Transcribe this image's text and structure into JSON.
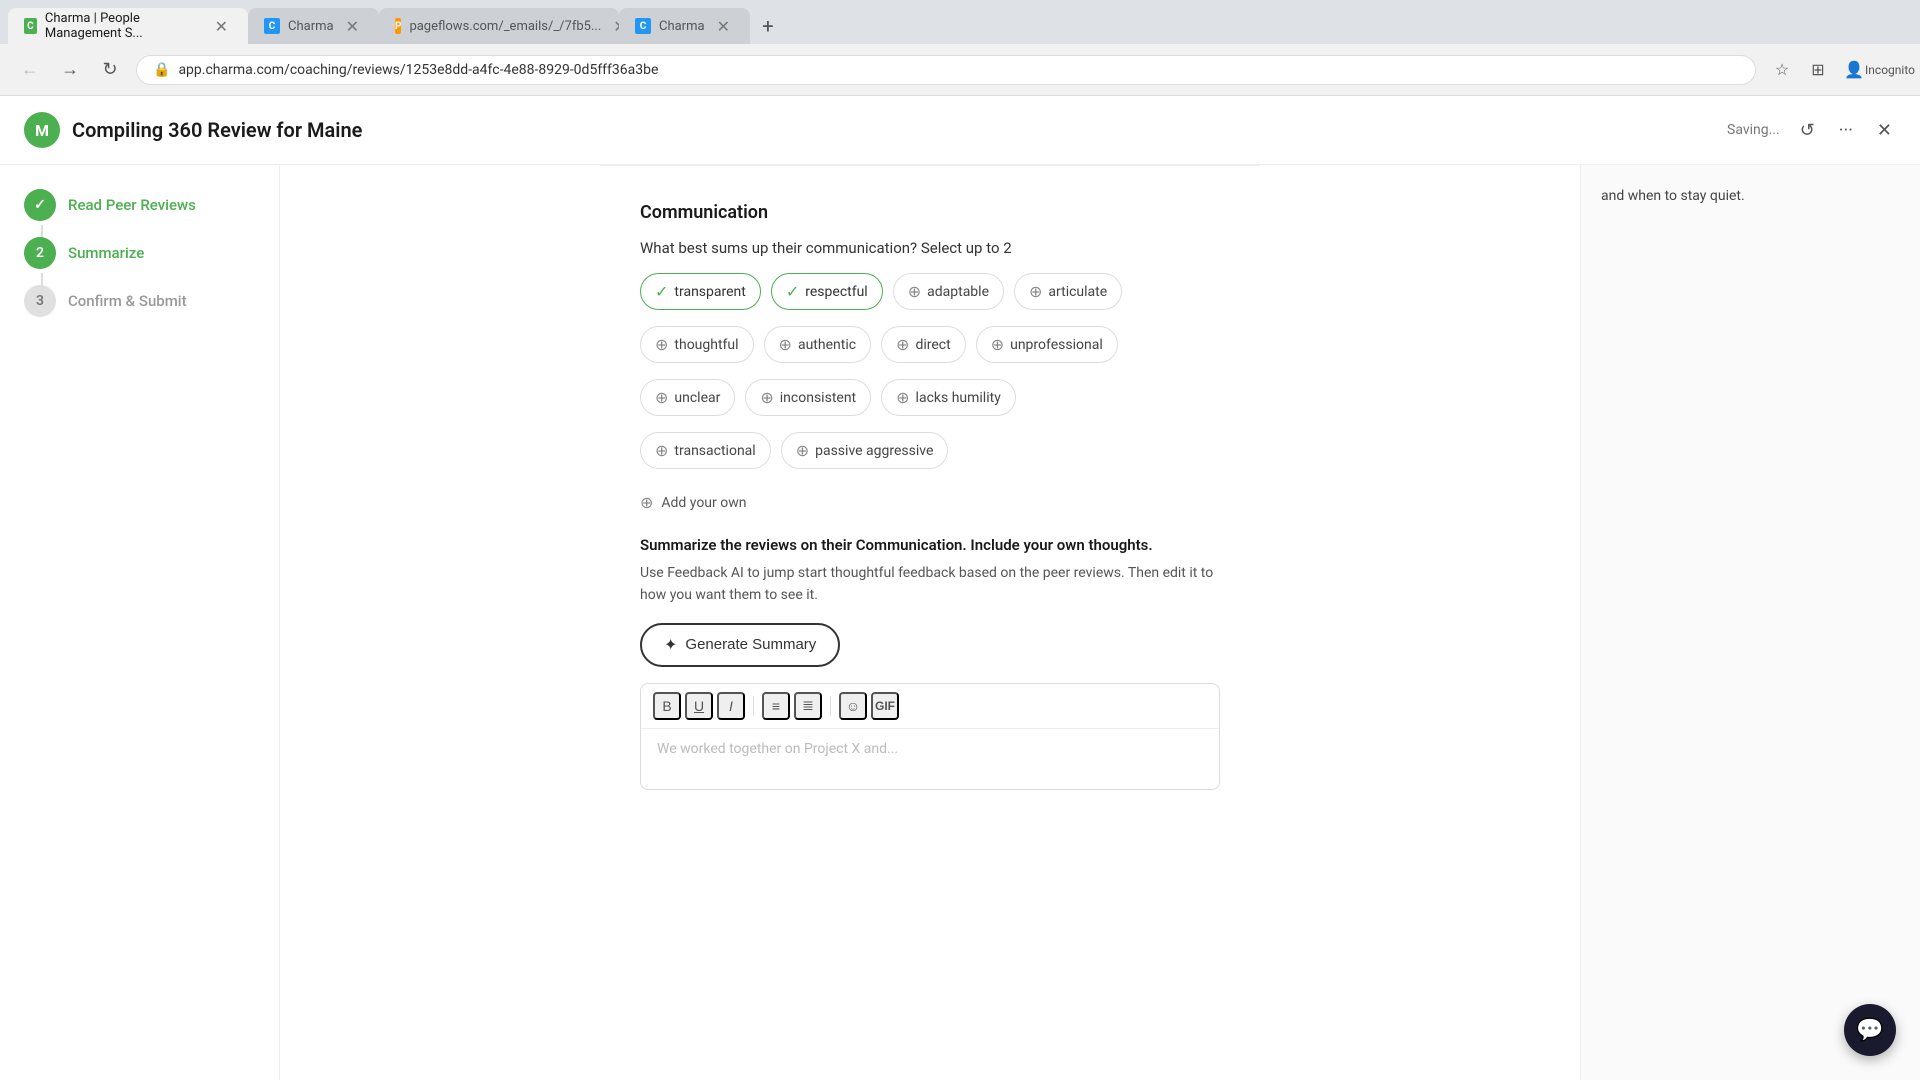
{
  "browser": {
    "tabs": [
      {
        "id": "tab1",
        "favicon": "charma",
        "label": "Charma | People Management S...",
        "active": true
      },
      {
        "id": "tab2",
        "favicon": "charma2",
        "label": "Charma",
        "active": false
      },
      {
        "id": "tab3",
        "favicon": "page",
        "label": "pageflows.com/_emails/_/7fb5...",
        "active": false
      },
      {
        "id": "tab4",
        "favicon": "charma2",
        "label": "Charma",
        "active": false
      }
    ],
    "address": "app.charma.com/coaching/reviews/1253e8dd-a4fc-4e88-8929-0d5fff36a3be",
    "incognito": true
  },
  "header": {
    "logo_letter": "M",
    "title": "Compiling 360 Review for Maine",
    "saving_text": "Saving...",
    "actions": {
      "history": "↺",
      "more": "···",
      "close": "✕"
    }
  },
  "sidebar": {
    "steps": [
      {
        "number": "✓",
        "label": "Read Peer Reviews",
        "state": "completed"
      },
      {
        "number": "2",
        "label": "Summarize",
        "state": "active"
      },
      {
        "number": "3",
        "label": "Confirm & Submit",
        "state": "inactive"
      }
    ]
  },
  "section": {
    "title": "Communication",
    "question": "What best sums up their communication? Select up to 2",
    "chips": [
      {
        "id": "transparent",
        "label": "transparent",
        "selected": true
      },
      {
        "id": "respectful",
        "label": "respectful",
        "selected": true
      },
      {
        "id": "adaptable",
        "label": "adaptable",
        "selected": false
      },
      {
        "id": "articulate",
        "label": "articulate",
        "selected": false
      },
      {
        "id": "thoughtful",
        "label": "thoughtful",
        "selected": false
      },
      {
        "id": "authentic",
        "label": "authentic",
        "selected": false
      },
      {
        "id": "direct",
        "label": "direct",
        "selected": false
      },
      {
        "id": "unprofessional",
        "label": "unprofessional",
        "selected": false
      },
      {
        "id": "unclear",
        "label": "unclear",
        "selected": false
      },
      {
        "id": "inconsistent",
        "label": "inconsistent",
        "selected": false
      },
      {
        "id": "lacks_humility",
        "label": "lacks humility",
        "selected": false
      },
      {
        "id": "transactional",
        "label": "transactional",
        "selected": false
      },
      {
        "id": "passive_aggressive",
        "label": "passive aggressive",
        "selected": false
      }
    ],
    "add_your_own": "Add your own",
    "summarize_heading": "Summarize the reviews on their Communication. Include your own thoughts.",
    "summarize_desc": "Use Feedback AI to jump start thoughtful feedback based on the peer reviews. Then edit it to how you want them to see it.",
    "generate_btn": "Generate Summary",
    "editor_placeholder": "We worked together on Project X and..."
  },
  "right_panel": {
    "text": "and when to stay quiet."
  },
  "toolbar": {
    "bold": "B",
    "underline": "U",
    "italic": "I",
    "bullet_list": "≡",
    "ordered_list": "≣",
    "emoji": "☺",
    "gif": "GIF"
  }
}
